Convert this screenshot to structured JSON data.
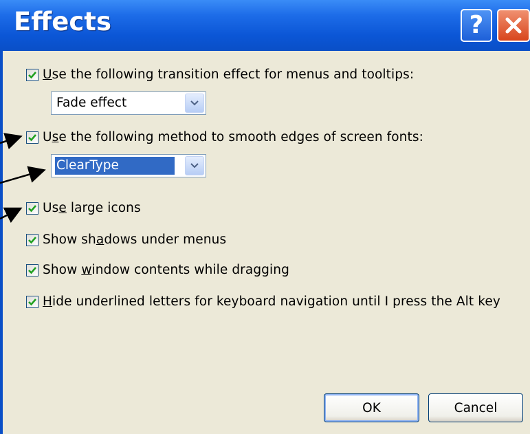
{
  "dialog": {
    "title": "Effects"
  },
  "options": [
    {
      "label_pre": "",
      "label_u": "U",
      "label_post": "se the following transition effect for menus and tooltips:",
      "checked": true
    },
    {
      "label_pre": "U",
      "label_u": "s",
      "label_post": "e the following method to smooth edges of screen fonts:",
      "checked": true
    },
    {
      "label_pre": "Us",
      "label_u": "e",
      "label_post": " large icons",
      "checked": true
    },
    {
      "label_pre": "Show sh",
      "label_u": "a",
      "label_post": "dows under menus",
      "checked": true
    },
    {
      "label_pre": "Show ",
      "label_u": "w",
      "label_post": "indow contents while dragging",
      "checked": true
    },
    {
      "label_pre": "",
      "label_u": "H",
      "label_post": "ide underlined letters for keyboard navigation until I press the Alt key",
      "checked": true
    }
  ],
  "transition_select": {
    "value": "Fade effect"
  },
  "smoothing_select": {
    "value": "ClearType"
  },
  "buttons": {
    "ok": "OK",
    "cancel": "Cancel"
  },
  "colors": {
    "titlebar": "#0a4fc7",
    "client": "#ece9d8",
    "selection": "#316ac5",
    "check": "#21a121"
  }
}
